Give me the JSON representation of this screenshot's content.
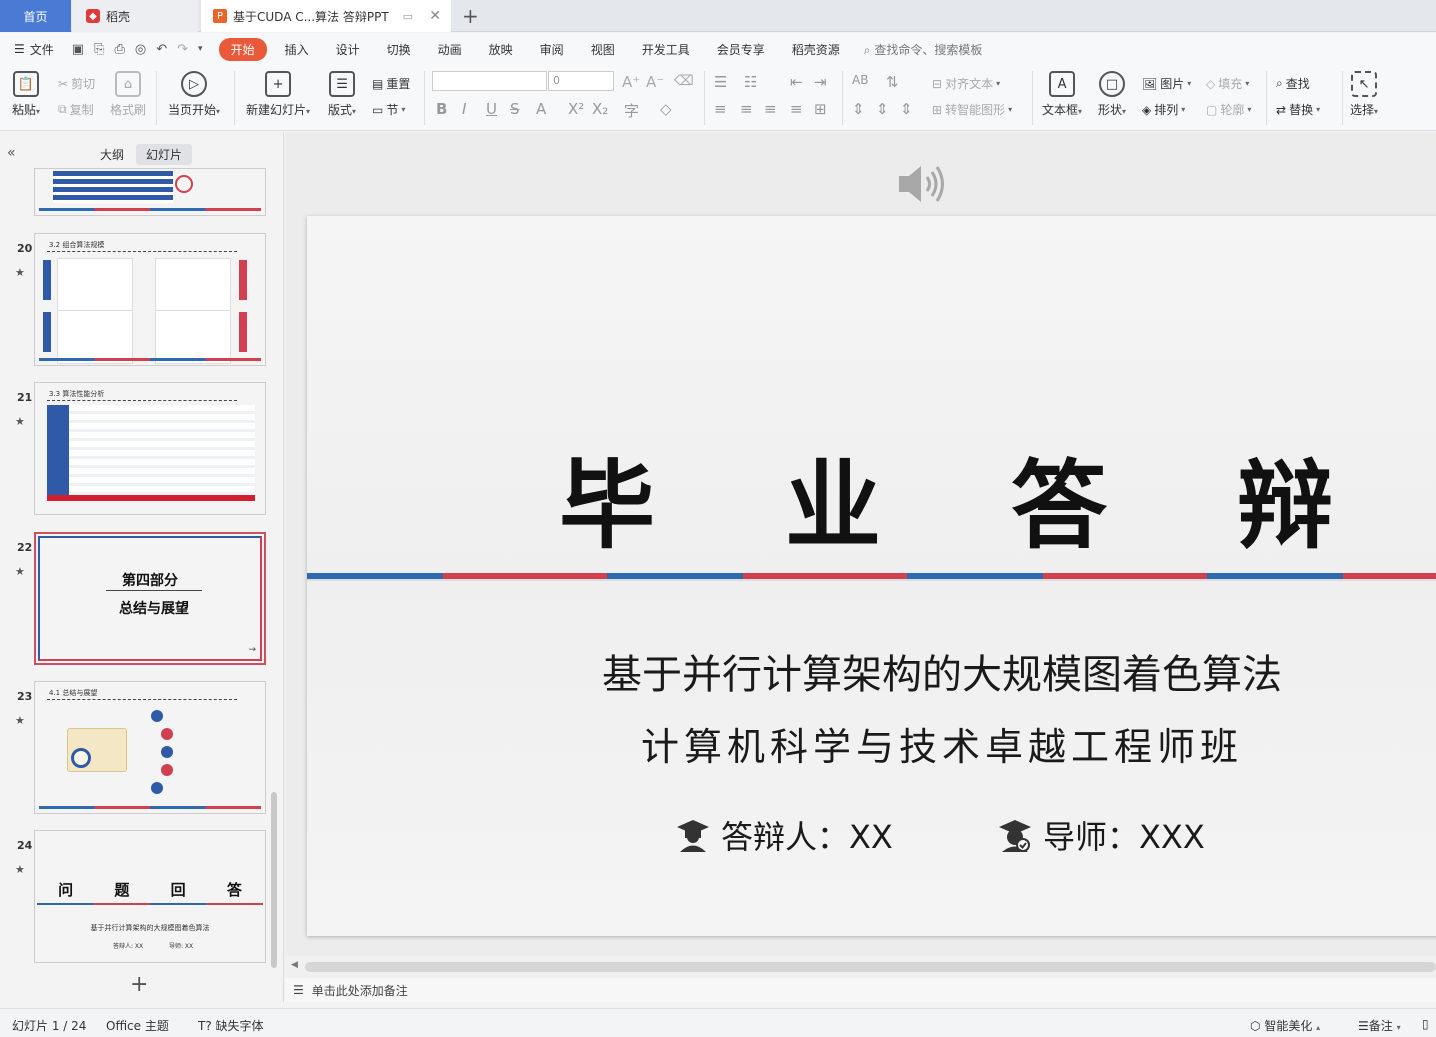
{
  "tabs": {
    "home": "首页",
    "daoke": "稻壳",
    "doc": "基于CUDA C...算法 答辩PPT"
  },
  "menu": {
    "file": "文件",
    "tabs": [
      "开始",
      "插入",
      "设计",
      "切换",
      "动画",
      "放映",
      "审阅",
      "视图",
      "开发工具",
      "会员专享",
      "稻壳资源"
    ],
    "search": "查找命令、搜索模板"
  },
  "ribbon": {
    "paste": "粘贴",
    "cut": "剪切",
    "copy": "复制",
    "format_painter": "格式刷",
    "from_current": "当页开始",
    "new_slide": "新建幻灯片",
    "layout": "版式",
    "reset": "重置",
    "section": "节",
    "font_size": "0",
    "align_text": "对齐文本",
    "smartart": "转智能图形",
    "textbox": "文本框",
    "shape": "形状",
    "picture": "图片",
    "arrange": "排列",
    "fill": "填充",
    "outline": "轮廓",
    "find": "查找",
    "replace": "替换",
    "select": "选择"
  },
  "panel": {
    "tab_outline": "大纲",
    "tab_slides": "幻灯片",
    "slides": [
      {
        "num": "20",
        "title": "3.2 组合算法规模"
      },
      {
        "num": "21",
        "title": "3.3 算法性能分析"
      },
      {
        "num": "22",
        "line1": "第四部分",
        "line2": "总结与展望"
      },
      {
        "num": "23",
        "title": "4.1 总结与展望"
      },
      {
        "num": "24",
        "title": "问 题 回 答",
        "sub": "基于并行计算架构的大规模图着色算法",
        "p1": "答辩人: XX",
        "p2": "导师: XX"
      }
    ]
  },
  "slide": {
    "title_chars": [
      "毕",
      "业",
      "答",
      "辩"
    ],
    "subtitle": "基于并行计算架构的大规模图着色算法",
    "subtitle2": "计算机科学与技术卓越工程师班",
    "presenter": "答辩人：XX",
    "advisor": "导师：XXX"
  },
  "notes_placeholder": "单击此处添加备注",
  "status": {
    "slide_count": "幻灯片 1 / 24",
    "theme": "Office 主题",
    "missing_font": "缺失字体",
    "beautify": "智能美化",
    "notes": "备注"
  },
  "colors": {
    "accent_blue": "#2f6ab0",
    "accent_red": "#d04050",
    "start_tab": "#e85a3a"
  }
}
